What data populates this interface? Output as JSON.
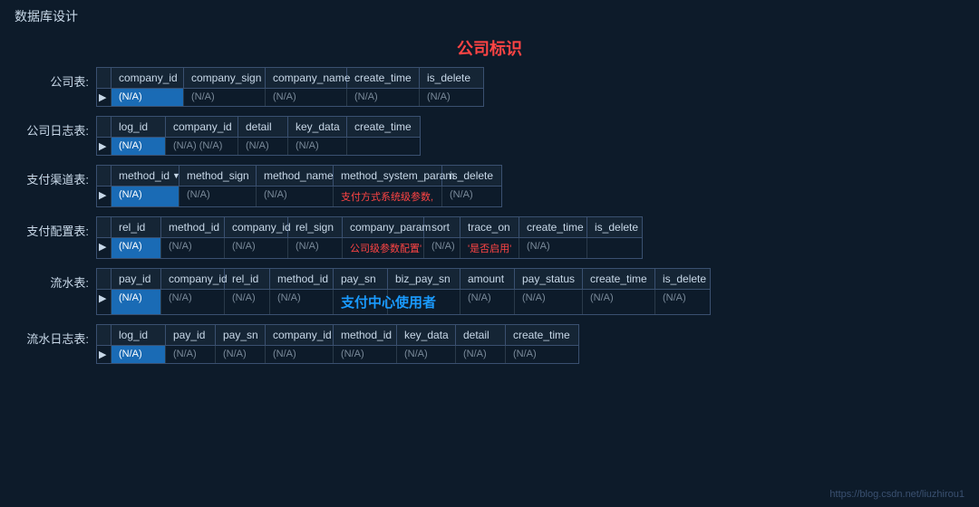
{
  "pageTitle": "数据库设计",
  "centerLabel": "公司标识",
  "watermark": "https://blog.csdn.net/liuzhirou1",
  "tables": [
    {
      "label": "公司表:",
      "headers": [
        "company_id",
        "company_sign",
        "company_name",
        "create_time",
        "is_delete"
      ],
      "headerWidths": [
        80,
        90,
        90,
        80,
        70
      ],
      "hasDropdown": false,
      "dataRow": [
        "(N/A)",
        "(N/A)",
        "(N/A)",
        "(N/A)",
        "(N/A)"
      ],
      "selectedIndex": 0
    },
    {
      "label": "公司日志表:",
      "headers": [
        "log_id",
        "company_id",
        "detail",
        "key_data",
        "create_time"
      ],
      "headerWidths": [
        60,
        80,
        55,
        65,
        80
      ],
      "hasDropdown": false,
      "dataRow": [
        "(N/A)",
        "(N/A)  (N/A)",
        "(N/A)",
        "(N/A)",
        ""
      ],
      "selectedIndex": 0,
      "dataRowRaw": [
        "(N/A)",
        "(N/A)",
        "(N/A)",
        "(N/A)",
        "(N/A)"
      ]
    },
    {
      "label": "支付渠道表:",
      "headers": [
        "method_id",
        "method_sign",
        "method_name",
        "method_system_param",
        "is_delete"
      ],
      "headerWidths": [
        75,
        85,
        85,
        120,
        65
      ],
      "hasDropdown": true,
      "dropdownCol": 0,
      "dataRow": [
        "(N/A)",
        "(N/A)",
        "(N/A)",
        "支付方式系统级参数,",
        "(N/A)"
      ],
      "selectedIndex": 0,
      "redCells": [
        3
      ]
    },
    {
      "label": "支付配置表:",
      "headers": [
        "rel_id",
        "method_id",
        "company_id",
        "rel_sign",
        "company_param",
        "sort",
        "trace_on",
        "create_time",
        "is_delete"
      ],
      "headerWidths": [
        55,
        70,
        70,
        60,
        90,
        40,
        65,
        75,
        60
      ],
      "hasDropdown": false,
      "dataRow": [
        "(N/A)",
        "(N/A)",
        "(N/A)",
        "(N/A)",
        "公司级参数配置'",
        "(N/A)",
        "'是否启用'",
        "(N/A)",
        ""
      ],
      "selectedIndex": 0,
      "redCells": [
        4,
        6
      ]
    },
    {
      "label": "流水表:",
      "headers": [
        "pay_id",
        "company_id",
        "rel_id",
        "method_id",
        "pay_sn",
        "biz_pay_sn",
        "amount",
        "pay_status",
        "create_time",
        "is_delete"
      ],
      "headerWidths": [
        55,
        70,
        50,
        70,
        60,
        80,
        60,
        75,
        80,
        60
      ],
      "hasDropdown": false,
      "dataRow": [
        "(N/A)",
        "(N/A)",
        "(N/A)",
        "(N/A)",
        "支付中心",
        "使用者",
        "(N/A)",
        "(N/A)",
        "(N/A)",
        "(N/A)"
      ],
      "selectedIndex": 0,
      "blueCells": [
        4,
        5
      ]
    },
    {
      "label": "流水日志表:",
      "headers": [
        "log_id",
        "pay_id",
        "pay_sn",
        "company_id",
        "method_id",
        "key_data",
        "detail",
        "create_time"
      ],
      "headerWidths": [
        60,
        55,
        55,
        75,
        70,
        65,
        55,
        80
      ],
      "hasDropdown": false,
      "dataRow": [
        "(N/A)",
        "(N/A)",
        "(N/A)",
        "(N/A)",
        "(N/A)",
        "(N/A)",
        "(N/A)",
        "(N/A)"
      ],
      "selectedIndex": 0
    }
  ]
}
